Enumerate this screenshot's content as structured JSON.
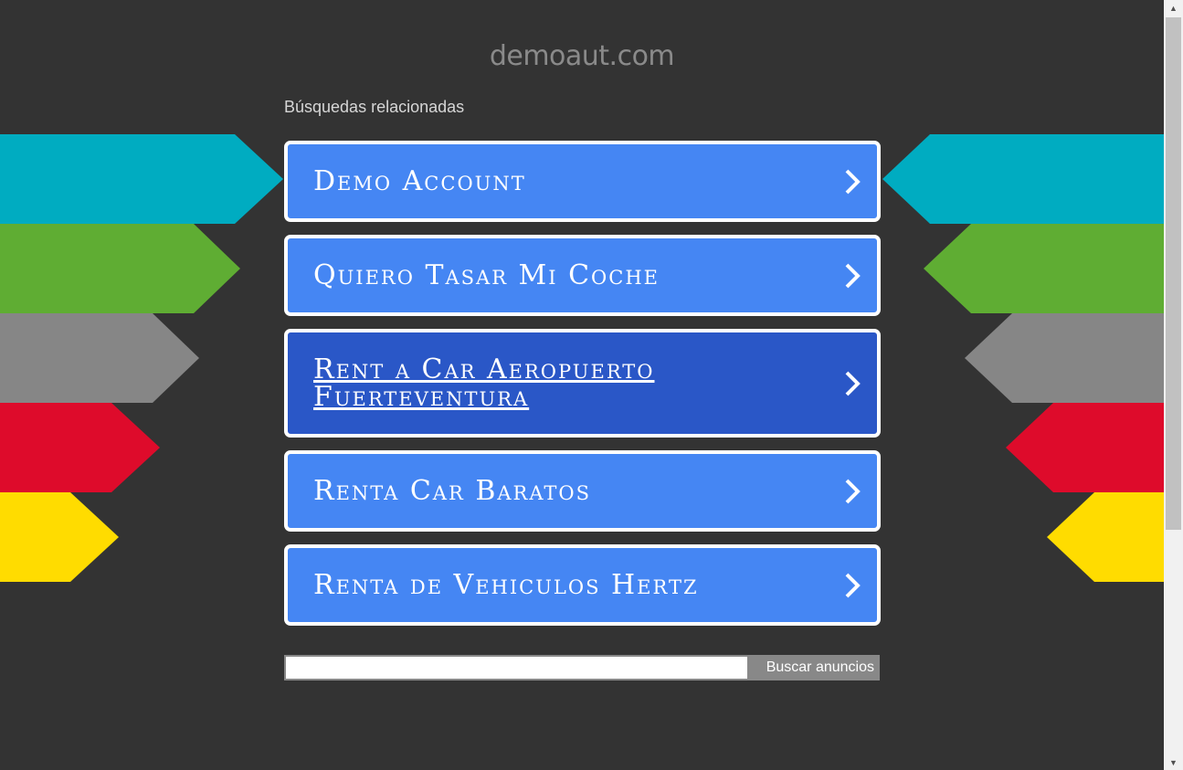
{
  "site": {
    "domain": "demoaut.com"
  },
  "related": {
    "heading": "Búsquedas relacionadas",
    "links": [
      {
        "label": "Demo Account"
      },
      {
        "label": "Quiero Tasar Mi Coche"
      },
      {
        "label": "Rent a Car Aeropuerto Fuerteventura"
      },
      {
        "label": "Renta Car Baratos"
      },
      {
        "label": "Renta de Vehiculos Hertz"
      }
    ],
    "chevron_icon": "chevron-right-icon"
  },
  "search": {
    "input_value": "",
    "button_label": "Buscar anuncios"
  },
  "colors": {
    "background": "#333333",
    "link_box": "#4586f3",
    "link_box_active": "#2a57c7",
    "arrow_teal": "#00acc1",
    "arrow_green": "#5fad33",
    "arrow_gray": "#868686",
    "arrow_red": "#de0b2b",
    "arrow_yellow": "#ffdc00"
  }
}
